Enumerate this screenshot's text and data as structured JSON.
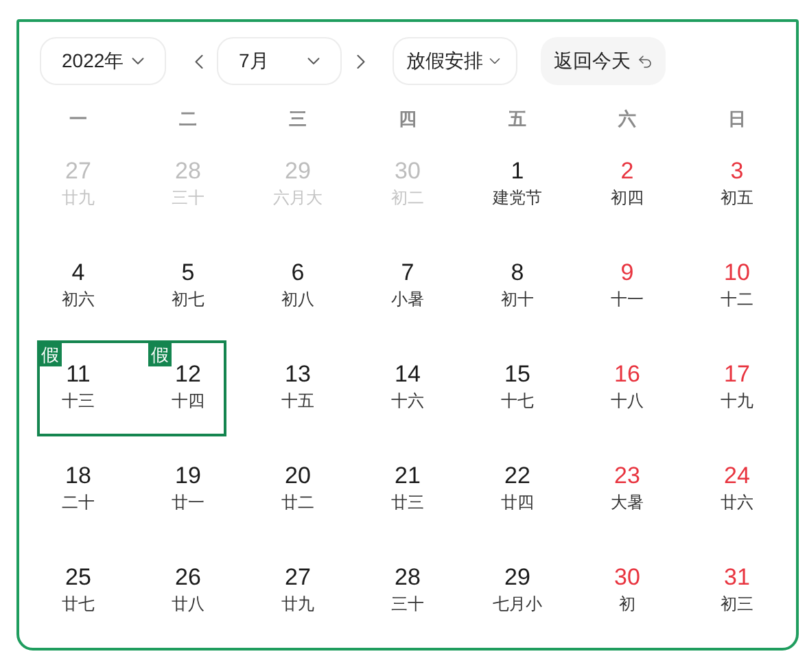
{
  "toolbar": {
    "year_select": {
      "value": "2022年"
    },
    "month_select": {
      "value": "7月"
    },
    "holiday_select": {
      "value": "放假安排"
    },
    "today_button": {
      "label": "返回今天"
    }
  },
  "weekdays": [
    "一",
    "二",
    "三",
    "四",
    "五",
    "六",
    "日"
  ],
  "days": [
    {
      "day": "27",
      "lunar": "廿九",
      "muted": true,
      "weekend": false,
      "selected": false
    },
    {
      "day": "28",
      "lunar": "三十",
      "muted": true,
      "weekend": false,
      "selected": false
    },
    {
      "day": "29",
      "lunar": "六月大",
      "muted": true,
      "weekend": false,
      "selected": false
    },
    {
      "day": "30",
      "lunar": "初二",
      "muted": true,
      "weekend": false,
      "selected": false
    },
    {
      "day": "1",
      "lunar": "建党节",
      "muted": false,
      "weekend": false,
      "selected": false
    },
    {
      "day": "2",
      "lunar": "初四",
      "muted": false,
      "weekend": true,
      "selected": false
    },
    {
      "day": "3",
      "lunar": "初五",
      "muted": false,
      "weekend": true,
      "selected": false
    },
    {
      "day": "4",
      "lunar": "初六",
      "muted": false,
      "weekend": false,
      "selected": false
    },
    {
      "day": "5",
      "lunar": "初七",
      "muted": false,
      "weekend": false,
      "selected": false
    },
    {
      "day": "6",
      "lunar": "初八",
      "muted": false,
      "weekend": false,
      "selected": false
    },
    {
      "day": "7",
      "lunar": "小暑",
      "muted": false,
      "weekend": false,
      "selected": false
    },
    {
      "day": "8",
      "lunar": "初十",
      "muted": false,
      "weekend": false,
      "selected": false
    },
    {
      "day": "9",
      "lunar": "十一",
      "muted": false,
      "weekend": true,
      "selected": false
    },
    {
      "day": "10",
      "lunar": "十二",
      "muted": false,
      "weekend": true,
      "selected": false
    },
    {
      "day": "11",
      "lunar": "十三",
      "muted": false,
      "weekend": false,
      "selected": true,
      "badge": "假"
    },
    {
      "day": "12",
      "lunar": "十四",
      "muted": false,
      "weekend": false,
      "selected": true,
      "badge": "假"
    },
    {
      "day": "13",
      "lunar": "十五",
      "muted": false,
      "weekend": false,
      "selected": false
    },
    {
      "day": "14",
      "lunar": "十六",
      "muted": false,
      "weekend": false,
      "selected": false
    },
    {
      "day": "15",
      "lunar": "十七",
      "muted": false,
      "weekend": false,
      "selected": false
    },
    {
      "day": "16",
      "lunar": "十八",
      "muted": false,
      "weekend": true,
      "selected": false
    },
    {
      "day": "17",
      "lunar": "十九",
      "muted": false,
      "weekend": true,
      "selected": false
    },
    {
      "day": "18",
      "lunar": "二十",
      "muted": false,
      "weekend": false,
      "selected": false
    },
    {
      "day": "19",
      "lunar": "廿一",
      "muted": false,
      "weekend": false,
      "selected": false
    },
    {
      "day": "20",
      "lunar": "廿二",
      "muted": false,
      "weekend": false,
      "selected": false
    },
    {
      "day": "21",
      "lunar": "廿三",
      "muted": false,
      "weekend": false,
      "selected": false
    },
    {
      "day": "22",
      "lunar": "廿四",
      "muted": false,
      "weekend": false,
      "selected": false
    },
    {
      "day": "23",
      "lunar": "大暑",
      "muted": false,
      "weekend": true,
      "selected": false
    },
    {
      "day": "24",
      "lunar": "廿六",
      "muted": false,
      "weekend": true,
      "selected": false
    },
    {
      "day": "25",
      "lunar": "廿七",
      "muted": false,
      "weekend": false,
      "selected": false
    },
    {
      "day": "26",
      "lunar": "廿八",
      "muted": false,
      "weekend": false,
      "selected": false
    },
    {
      "day": "27",
      "lunar": "廿九",
      "muted": false,
      "weekend": false,
      "selected": false
    },
    {
      "day": "28",
      "lunar": "三十",
      "muted": false,
      "weekend": false,
      "selected": false
    },
    {
      "day": "29",
      "lunar": "七月小",
      "muted": false,
      "weekend": false,
      "selected": false
    },
    {
      "day": "30",
      "lunar": "初",
      "muted": false,
      "weekend": true,
      "selected": false
    },
    {
      "day": "31",
      "lunar": "初三",
      "muted": false,
      "weekend": true,
      "selected": false
    }
  ]
}
